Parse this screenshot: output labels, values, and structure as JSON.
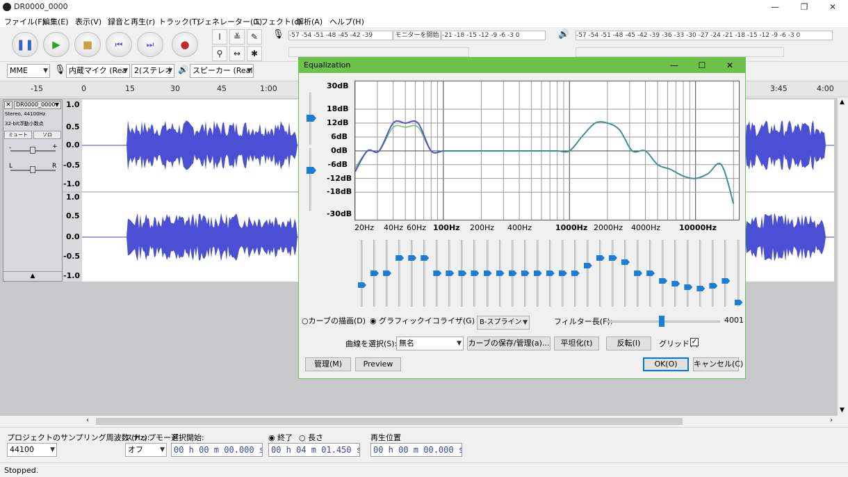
{
  "window": {
    "title": "DR0000_0000",
    "min": "—",
    "max": "❐",
    "close": "✕"
  },
  "menu": [
    "ファイル(F)",
    "編集(E)",
    "表示(V)",
    "録音と再生(r)",
    "トラック(T)",
    "ジェネレーター(G)",
    "エフェクト(c)",
    "解析(A)",
    "ヘルプ(H)"
  ],
  "meters": {
    "rec_scale": "-57 -54 -51 -48 -45 -42 -39",
    "rec_monitor": "モニターを開始",
    "rec_scale2": "-21 -18 -15 -12 -9 -6 -3 0",
    "play_scale": "-57 -54 -51 -48 -45 -42 -39 -36 -33 -30 -27 -24 -21 -18 -15 -12 -9 -6 -3 0"
  },
  "device": {
    "host": "MME",
    "mic": "内蔵マイク (Rea",
    "channels": "2(ステレオ",
    "speaker": "スピーカー (Real"
  },
  "ruler": [
    "-15",
    "0",
    "15",
    "30",
    "45",
    "1:00",
    "3:45",
    "4:00"
  ],
  "track": {
    "name": "DR0000_0000",
    "info1": "Stereo, 44100Hz",
    "info2": "32-bit浮動小数点",
    "mute": "ミュート",
    "solo": "ソロ",
    "left": "L",
    "right": "R",
    "minus": "-",
    "plus": "+",
    "scale": [
      "1.0",
      "0.5",
      "0.0",
      "-0.5",
      "-1.0"
    ]
  },
  "dialog": {
    "title": "Equalization",
    "db_labels": [
      "30dB",
      "18dB",
      "12dB",
      "6dB",
      "0dB",
      "-6dB",
      "-12dB",
      "-18dB",
      "-30dB"
    ],
    "hz_labels": [
      "20Hz",
      "40Hz",
      "60Hz",
      "100Hz",
      "200Hz",
      "400Hz",
      "1000Hz",
      "2000Hz",
      "4000Hz",
      "10000Hz"
    ],
    "mode_draw": "カーブの描画(D)",
    "mode_graphic": "グラフィックイコライザ(G)",
    "interp": "B-スプライン",
    "filter_label": "フィルター長(F):",
    "filter_value": "4001",
    "curve_label": "曲線を選択(S):",
    "curve_value": "無名",
    "save_curves": "カーブの保存/管理(a)...",
    "flatten": "平坦化(t)",
    "invert": "反転(I)",
    "grid_label": "グリッド(r)",
    "grid_checked": true,
    "manage": "管理(M)",
    "preview": "Preview",
    "ok": "OK(O)",
    "cancel": "キャンセル(C)",
    "slider_gains_db": [
      -9,
      0,
      0,
      12,
      12,
      12,
      0,
      0,
      0,
      0,
      0,
      0,
      0,
      0,
      0,
      0,
      0,
      0,
      6,
      12,
      12,
      9,
      0,
      0,
      -6,
      -8,
      -11,
      -12,
      -10,
      -6,
      -23
    ]
  },
  "bottom": {
    "rate_label": "プロジェクトのサンプリング周波数 (Hz):",
    "rate_value": "44100",
    "snap_label": "スナップモード",
    "snap_value": "オフ",
    "sel_start_label": "選択開始:",
    "sel_start": "00 h 00 m 00.000 s",
    "end_label": "終了",
    "length_label": "長さ",
    "sel_end": "00 h 04 m 01.450 s",
    "pos_label": "再生位置",
    "pos": "00 h 00 m 00.000 s"
  },
  "status": "Stopped."
}
